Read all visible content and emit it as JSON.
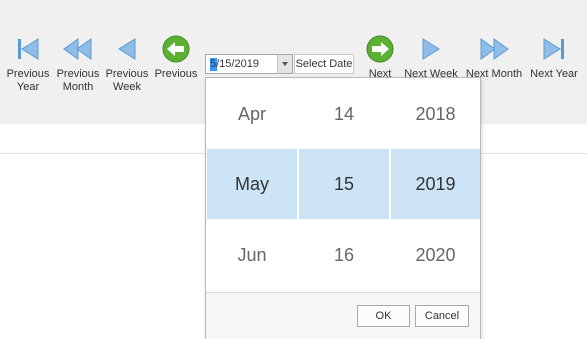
{
  "toolbar": {
    "buttons": [
      {
        "line1": "Previous",
        "line2": "Year"
      },
      {
        "line1": "Previous",
        "line2": "Month"
      },
      {
        "line1": "Previous",
        "line2": "Week"
      },
      {
        "line1": "Previous",
        "line2": ""
      },
      {
        "line1": "Next",
        "line2": ""
      },
      {
        "line1": "Next Week",
        "line2": ""
      },
      {
        "line1": "Next Month",
        "line2": ""
      },
      {
        "line1": "Next Year",
        "line2": ""
      }
    ],
    "date_value": "5/15/2019",
    "select_date_label": "Select Date"
  },
  "picker": {
    "rows": [
      {
        "month": "Apr",
        "day": "14",
        "year": "2018"
      },
      {
        "month": "May",
        "day": "15",
        "year": "2019"
      },
      {
        "month": "Jun",
        "day": "16",
        "year": "2020"
      }
    ],
    "ok_label": "OK",
    "cancel_label": "Cancel"
  },
  "colors": {
    "nav_arrow": "#5b9bd5",
    "green_button": "#5cb135",
    "selection": "#cde4f6"
  }
}
